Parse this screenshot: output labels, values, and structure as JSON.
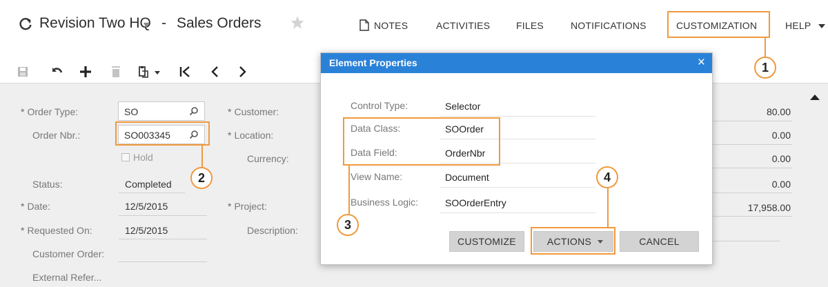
{
  "header": {
    "refresh_icon": "refresh-icon",
    "company": "Revision Two HQ",
    "company_caret": "▾",
    "separator": "-",
    "page_title": "Sales Orders",
    "favorite_icon": "star-icon"
  },
  "menu": {
    "notes": "NOTES",
    "activities": "ACTIVITIES",
    "files": "FILES",
    "notifications": "NOTIFICATIONS",
    "customization": "CUSTOMIZATION",
    "help": "HELP"
  },
  "toolbar": {
    "icons": [
      "save-icon",
      "undo-icon",
      "add-icon",
      "delete-icon",
      "copy-paste-icon",
      "first-record-icon",
      "previous-record-icon",
      "next-record-icon"
    ]
  },
  "form": {
    "order_type_label": "Order Type:",
    "order_type_value": "SO",
    "order_nbr_label": "Order Nbr.:",
    "order_nbr_value": "SO003345",
    "hold_label": "Hold",
    "status_label": "Status:",
    "status_value": "Completed",
    "date_label": "Date:",
    "date_value": "12/5/2015",
    "requested_on_label": "Requested On:",
    "requested_on_value": "12/5/2015",
    "customer_order_label": "Customer Order:",
    "external_ref_label": "External Refer...",
    "customer_label": "Customer:",
    "location_label": "Location:",
    "currency_label": "Currency:",
    "project_label": "Project:",
    "description_label": "Description:",
    "required_mark": "*"
  },
  "totals": [
    "80.00",
    "0.00",
    "0.00",
    "0.00",
    "17,958.00"
  ],
  "dialog": {
    "title": "Element Properties",
    "close": "×",
    "properties": [
      {
        "label": "Control Type:",
        "value": "Selector"
      },
      {
        "label": "Data Class:",
        "value": "SOOrder"
      },
      {
        "label": "Data Field:",
        "value": "OrderNbr"
      },
      {
        "label": "View Name:",
        "value": "Document"
      },
      {
        "label": "Business Logic:",
        "value": "SOOrderEntry"
      }
    ],
    "buttons": {
      "customize": "CUSTOMIZE",
      "actions": "ACTIONS",
      "cancel": "CANCEL"
    }
  },
  "callouts": [
    "1",
    "2",
    "3",
    "4"
  ],
  "colors": {
    "accent_orange": "#f0993c",
    "dialog_header_blue": "#2a82d8",
    "form_background": "#efefef"
  }
}
